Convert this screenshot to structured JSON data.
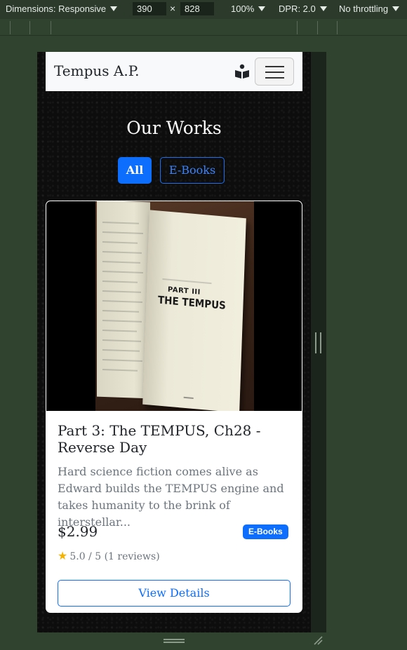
{
  "devtools": {
    "dimensions_label": "Dimensions: Responsive",
    "width": "390",
    "times": "×",
    "height": "828",
    "zoom": "100%",
    "dpr": "DPR: 2.0",
    "throttling": "No throttling"
  },
  "site": {
    "brand": "Tempus A.P.",
    "section_title": "Our Works",
    "filters": [
      "All",
      "E-Books"
    ],
    "active_filter": "All"
  },
  "card": {
    "image_text": {
      "part": "PART III",
      "title": "THE TEMPUS"
    },
    "title": "Part 3: The TEMPUS, Ch28 - Reverse Day",
    "description": "Hard science fiction comes alive as Edward builds the TEMPUS engine and takes humanity to the brink of interstellar...",
    "price": "$2.99",
    "badge": "E-Books",
    "rating": "5.0 / 5 (1 reviews)",
    "button": "View Details"
  },
  "colors": {
    "primary": "#0d6efd",
    "navbar_bg": "#f8f9fa",
    "page_bg": "#0d0d0d",
    "star": "#f5b301"
  }
}
